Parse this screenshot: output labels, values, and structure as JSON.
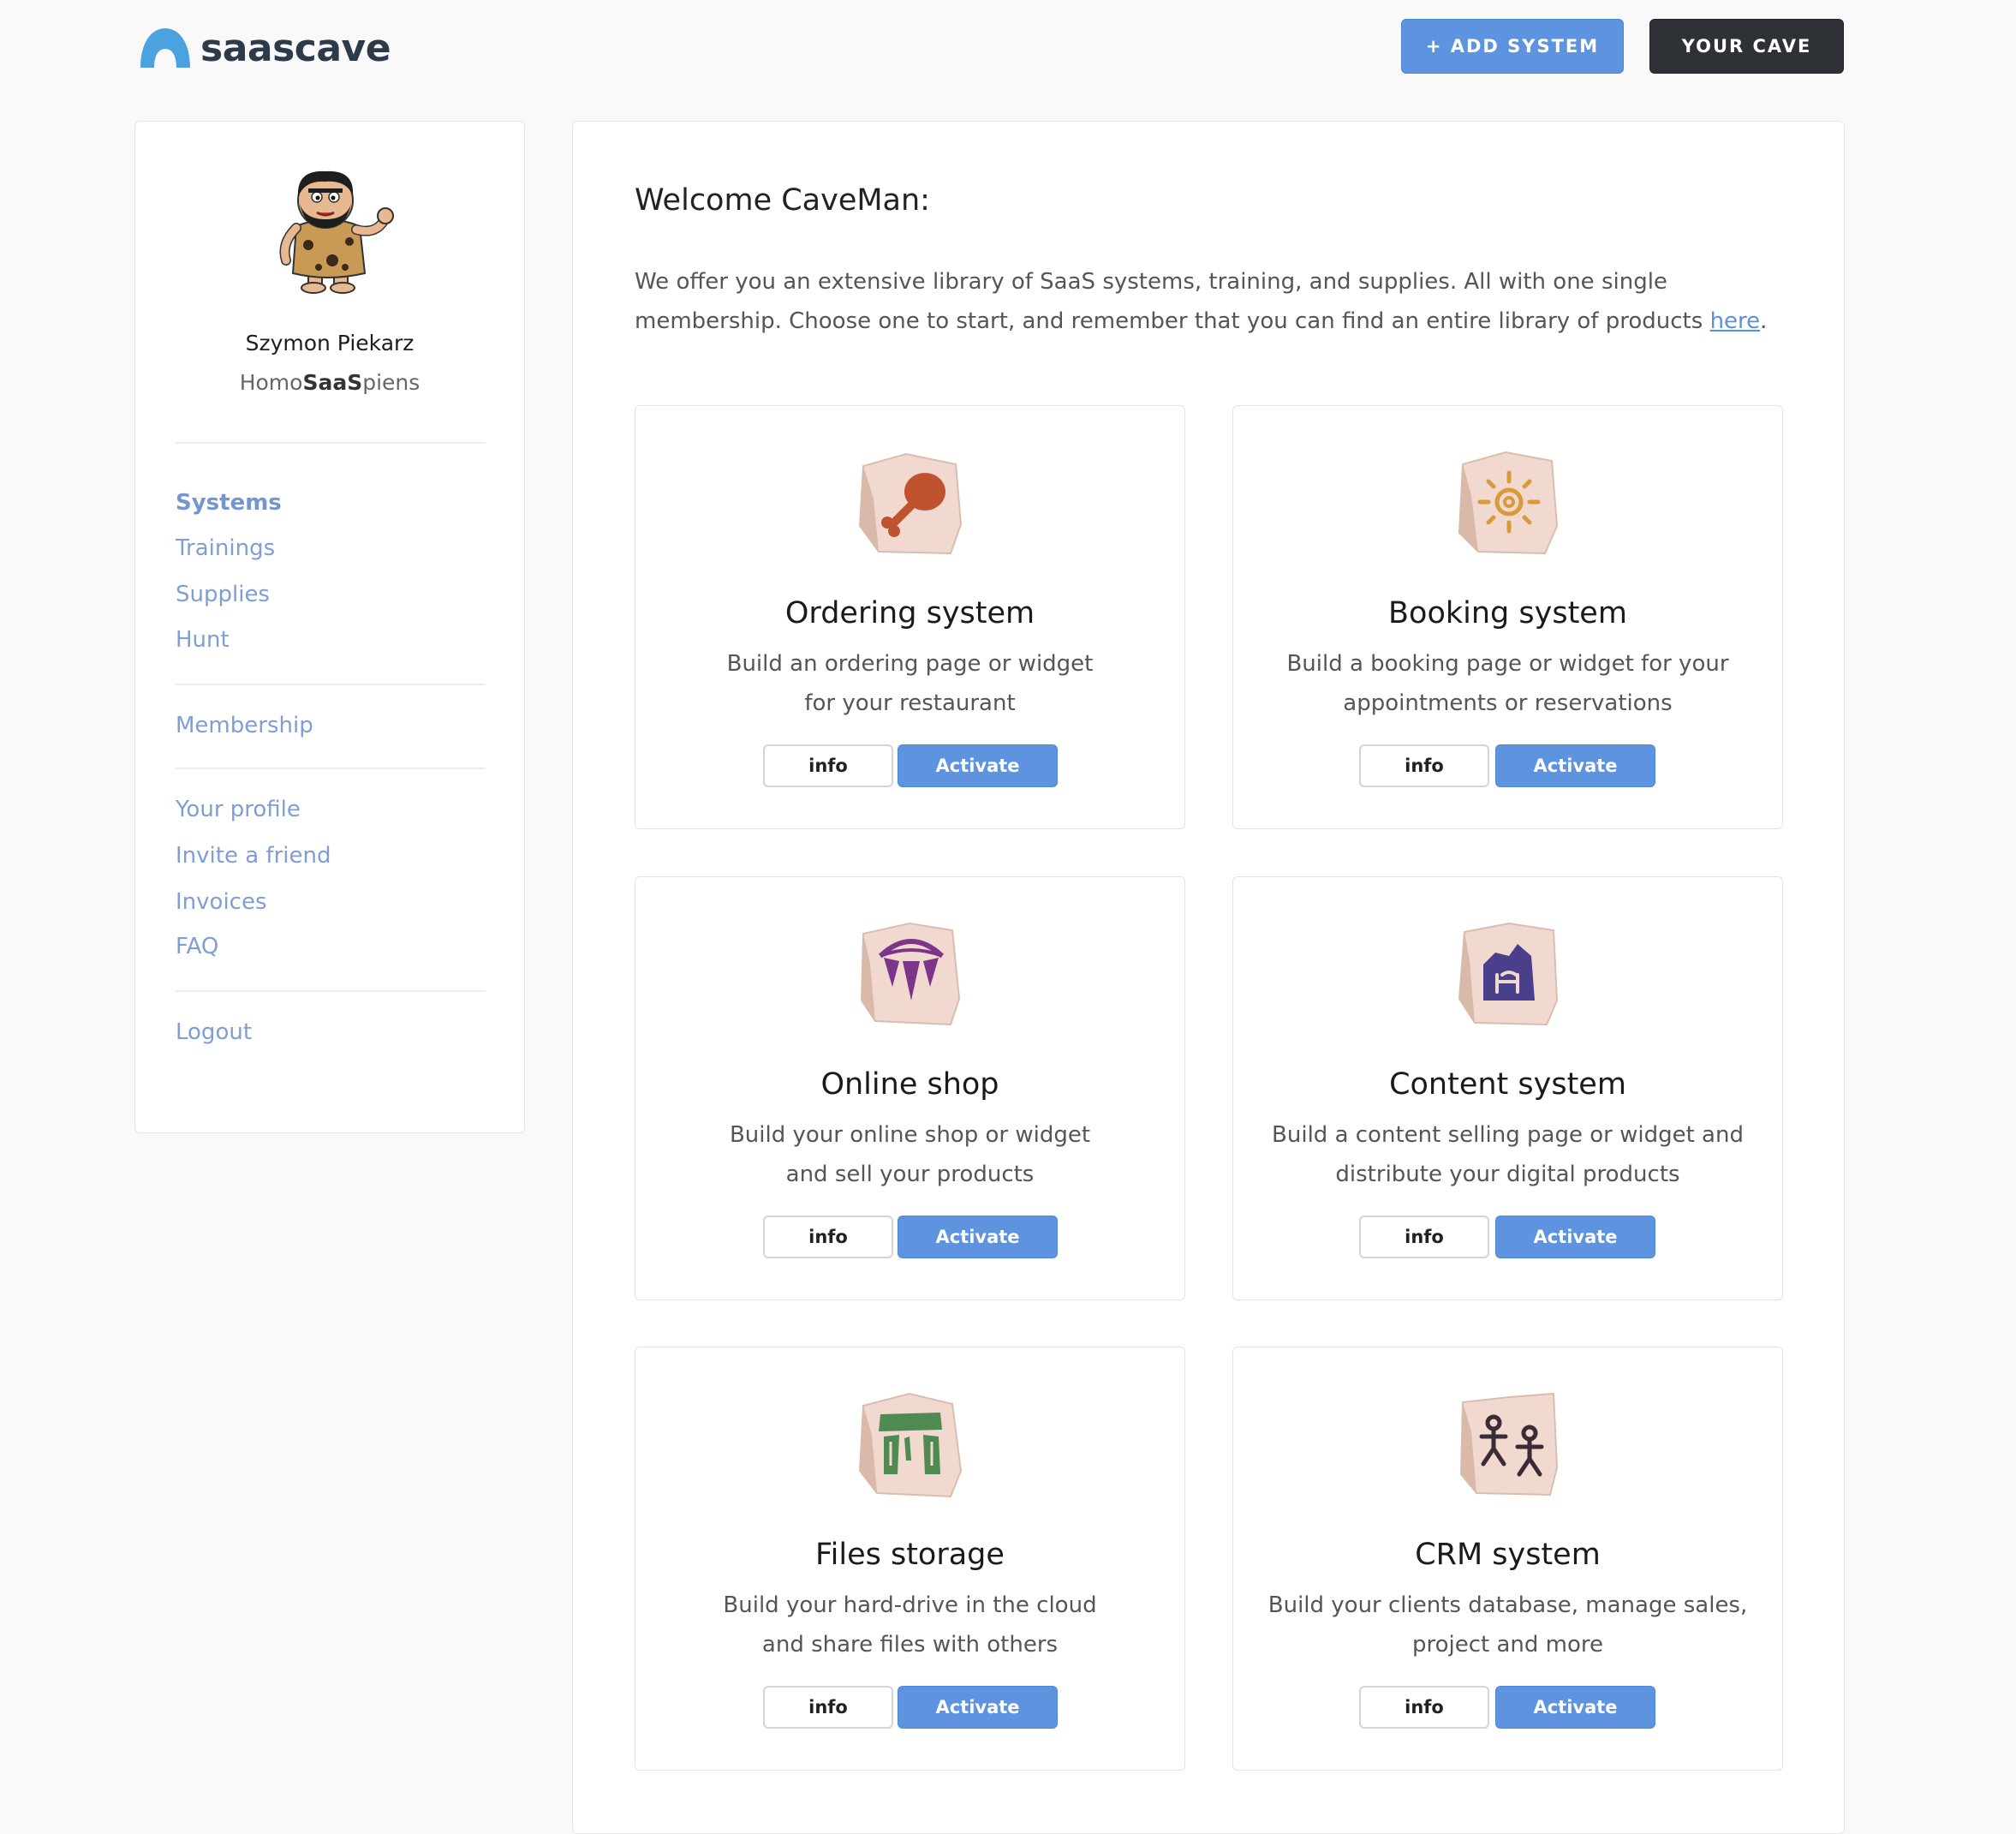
{
  "header": {
    "logo_text": "saascave",
    "add_system_label": "+ ADD SYSTEM",
    "your_cave_label": "YOUR CAVE"
  },
  "profile": {
    "name": "Szymon Piekarz",
    "rank_prefix": "Homo",
    "rank_bold": "SaaS",
    "rank_suffix": "piens"
  },
  "nav": {
    "systems": "Systems",
    "trainings": "Trainings",
    "supplies": "Supplies",
    "hunt": "Hunt",
    "membership": "Membership",
    "your_profile": "Your profile",
    "invite": "Invite a friend",
    "invoices": "Invoices",
    "faq": "FAQ",
    "logout": "Logout"
  },
  "main": {
    "welcome": "Welcome CaveMan:",
    "intro_text": "We offer you an extensive library of SaaS systems, training, and supplies. All with one single membership. Choose one to start, and remember that you can find an entire library of products ",
    "intro_link": "here",
    "intro_end": "."
  },
  "cards": [
    {
      "title": "Ordering system",
      "desc_line1": "Build an ordering page or widget",
      "desc_line2": "for your restaurant",
      "icon": "drumstick-icon",
      "info_label": "info",
      "activate_label": "Activate"
    },
    {
      "title": "Booking system",
      "desc_line1": "Build a booking page or widget for your",
      "desc_line2": "appointments or reservations",
      "icon": "sun-spiral-icon",
      "info_label": "info",
      "activate_label": "Activate"
    },
    {
      "title": "Online shop",
      "desc_line1": "Build your online shop or widget",
      "desc_line2": "and sell your products",
      "icon": "fang-necklace-icon",
      "info_label": "info",
      "activate_label": "Activate"
    },
    {
      "title": "Content system",
      "desc_line1": "Build a content selling page or widget and",
      "desc_line2": "distribute your digital products",
      "icon": "cave-painting-icon",
      "info_label": "info",
      "activate_label": "Activate"
    },
    {
      "title": "Files storage",
      "desc_line1": "Build your hard-drive in the cloud",
      "desc_line2": "and share files with others",
      "icon": "stonehenge-icon",
      "info_label": "info",
      "activate_label": "Activate"
    },
    {
      "title": "CRM system",
      "desc_line1": "Build your clients database, manage sales,",
      "desc_line2": "project and more",
      "icon": "stick-figures-icon",
      "info_label": "info",
      "activate_label": "Activate"
    }
  ],
  "colors": {
    "accent": "#5e93e0",
    "dark_button": "#2e3236",
    "nav_link": "#7f9ed3",
    "stone": "#f2d9cf",
    "drumstick": "#c0532f",
    "sun": "#d99a3c",
    "necklace": "#7b3589",
    "cave": "#4a3f8a",
    "stonehenge": "#4e8a52",
    "figures": "#3b2b36"
  }
}
